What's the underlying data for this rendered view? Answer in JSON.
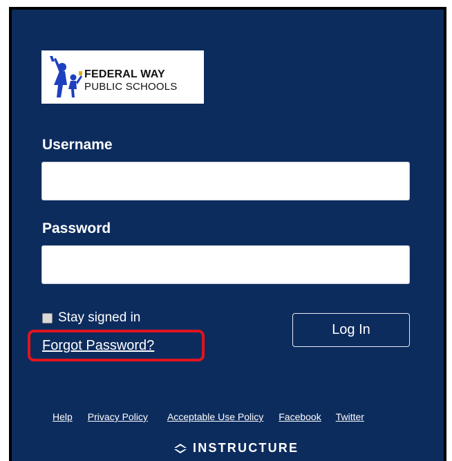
{
  "logo": {
    "line1": "FEDERAL WAY",
    "line2": "PUBLIC SCHOOLS"
  },
  "form": {
    "username_label": "Username",
    "username_value": "",
    "password_label": "Password",
    "password_value": "",
    "stay_signed_in_label": "Stay signed in",
    "stay_signed_in_checked": false,
    "forgot_password_label": "Forgot Password?",
    "login_button_label": "Log In"
  },
  "footer": {
    "links": [
      "Help",
      "Privacy Policy",
      "Acceptable Use Policy",
      "Facebook",
      "Twitter"
    ],
    "brand": "INSTRUCTURE"
  },
  "colors": {
    "panel_background": "#0d2c5e",
    "highlight": "#e0141e",
    "text": "#ffffff"
  }
}
